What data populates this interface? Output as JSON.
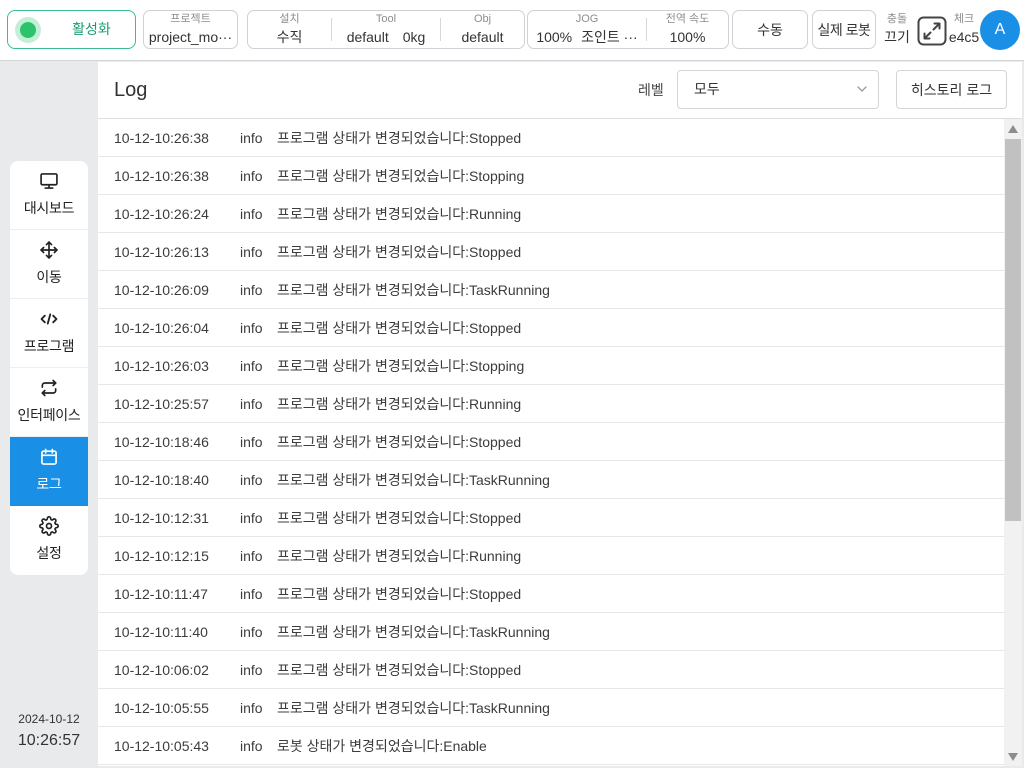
{
  "colors": {
    "accent": "#1a8fe6",
    "avatar": "#1a8fe6",
    "activate_border": "#3dbb93",
    "activate_text": "#1c9b73",
    "status_dot": "#2bc46d"
  },
  "topbar": {
    "activate": {
      "label": "활성화",
      "icon": "status-dot-icon"
    },
    "project": {
      "label": "프로젝트",
      "value": "project_mo···"
    },
    "install": {
      "label": "설치",
      "value": "수직"
    },
    "tool": {
      "label": "Tool",
      "name": "default",
      "weight": "0kg"
    },
    "obj": {
      "label": "Obj",
      "value": "default"
    },
    "jog": {
      "label": "JOG",
      "speed": "100%",
      "mode": "조인트 ···"
    },
    "global_speed": {
      "label": "전역 속도",
      "value": "100%"
    },
    "manual_label": "수동",
    "real_robot_label": "실제 로봇",
    "collision": {
      "label": "충돌",
      "value": "끄기"
    },
    "expand_icon": "expand-icon",
    "check": {
      "label": "체크",
      "value": "e4c5"
    },
    "avatar_initial": "A"
  },
  "sidebar": {
    "items": [
      {
        "label": "대시보드",
        "icon": "monitor-icon",
        "active": false
      },
      {
        "label": "이동",
        "icon": "move-icon",
        "active": false
      },
      {
        "label": "프로그램",
        "icon": "code-icon",
        "active": false
      },
      {
        "label": "인터페이스",
        "icon": "swap-icon",
        "active": false
      },
      {
        "label": "로그",
        "icon": "calendar-icon",
        "active": true
      },
      {
        "label": "설정",
        "icon": "gear-icon",
        "active": false
      }
    ],
    "date": "2024-10-12",
    "time": "10:26:57"
  },
  "log": {
    "title": "Log",
    "level_label": "레벨",
    "level_value": "모두",
    "history_button": "히스토리 로그",
    "entries": [
      {
        "time": "10-12-10:26:38",
        "level": "info",
        "message": "프로그램 상태가 변경되었습니다:Stopped"
      },
      {
        "time": "10-12-10:26:38",
        "level": "info",
        "message": "프로그램 상태가 변경되었습니다:Stopping"
      },
      {
        "time": "10-12-10:26:24",
        "level": "info",
        "message": "프로그램 상태가 변경되었습니다:Running"
      },
      {
        "time": "10-12-10:26:13",
        "level": "info",
        "message": "프로그램 상태가 변경되었습니다:Stopped"
      },
      {
        "time": "10-12-10:26:09",
        "level": "info",
        "message": "프로그램 상태가 변경되었습니다:TaskRunning"
      },
      {
        "time": "10-12-10:26:04",
        "level": "info",
        "message": "프로그램 상태가 변경되었습니다:Stopped"
      },
      {
        "time": "10-12-10:26:03",
        "level": "info",
        "message": "프로그램 상태가 변경되었습니다:Stopping"
      },
      {
        "time": "10-12-10:25:57",
        "level": "info",
        "message": "프로그램 상태가 변경되었습니다:Running"
      },
      {
        "time": "10-12-10:18:46",
        "level": "info",
        "message": "프로그램 상태가 변경되었습니다:Stopped"
      },
      {
        "time": "10-12-10:18:40",
        "level": "info",
        "message": "프로그램 상태가 변경되었습니다:TaskRunning"
      },
      {
        "time": "10-12-10:12:31",
        "level": "info",
        "message": "프로그램 상태가 변경되었습니다:Stopped"
      },
      {
        "time": "10-12-10:12:15",
        "level": "info",
        "message": "프로그램 상태가 변경되었습니다:Running"
      },
      {
        "time": "10-12-10:11:47",
        "level": "info",
        "message": "프로그램 상태가 변경되었습니다:Stopped"
      },
      {
        "time": "10-12-10:11:40",
        "level": "info",
        "message": "프로그램 상태가 변경되었습니다:TaskRunning"
      },
      {
        "time": "10-12-10:06:02",
        "level": "info",
        "message": "프로그램 상태가 변경되었습니다:Stopped"
      },
      {
        "time": "10-12-10:05:55",
        "level": "info",
        "message": "프로그램 상태가 변경되었습니다:TaskRunning"
      },
      {
        "time": "10-12-10:05:43",
        "level": "info",
        "message": "로봇 상태가 변경되었습니다:Enable"
      }
    ]
  }
}
